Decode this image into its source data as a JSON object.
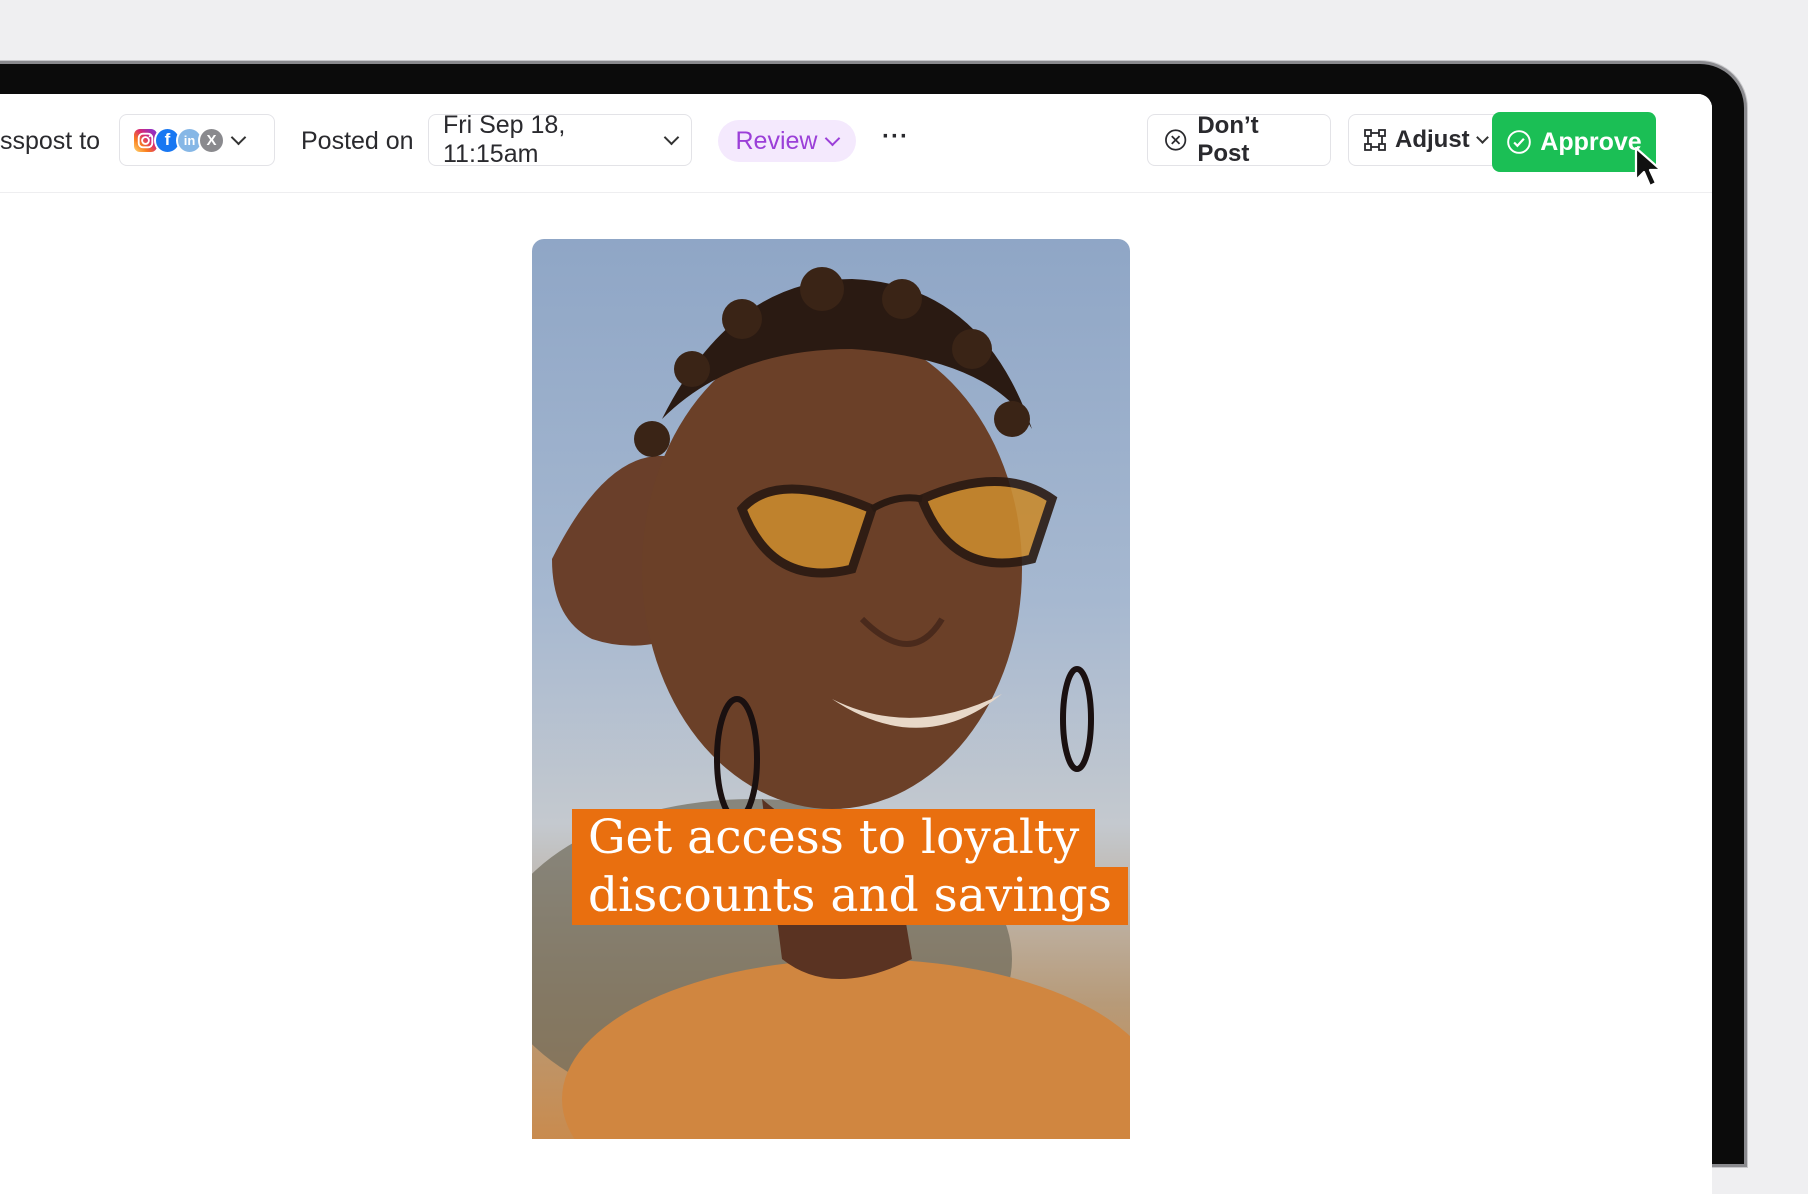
{
  "toolbar": {
    "crosspost_label": "sspost to",
    "networks": [
      {
        "name": "instagram-icon",
        "glyph": "◎"
      },
      {
        "name": "facebook-icon",
        "glyph": "f"
      },
      {
        "name": "linkedin-icon",
        "glyph": "in"
      },
      {
        "name": "x-icon",
        "glyph": "X"
      }
    ],
    "posted_on_label": "Posted on",
    "date_value": "Fri Sep 18, 11:15am",
    "status": "Review",
    "more_label": "···",
    "dont_post_label": "Don’t Post",
    "adjust_label": "Adjust",
    "approve_label": "Approve"
  },
  "post": {
    "caption_line1": "Get access to loyalty",
    "caption_line2": "discounts and savings"
  },
  "colors": {
    "approve": "#1bbf55",
    "status_text": "#9b3fd8",
    "status_bg": "#f4e9fd",
    "caption_bg": "#e96f0f"
  }
}
